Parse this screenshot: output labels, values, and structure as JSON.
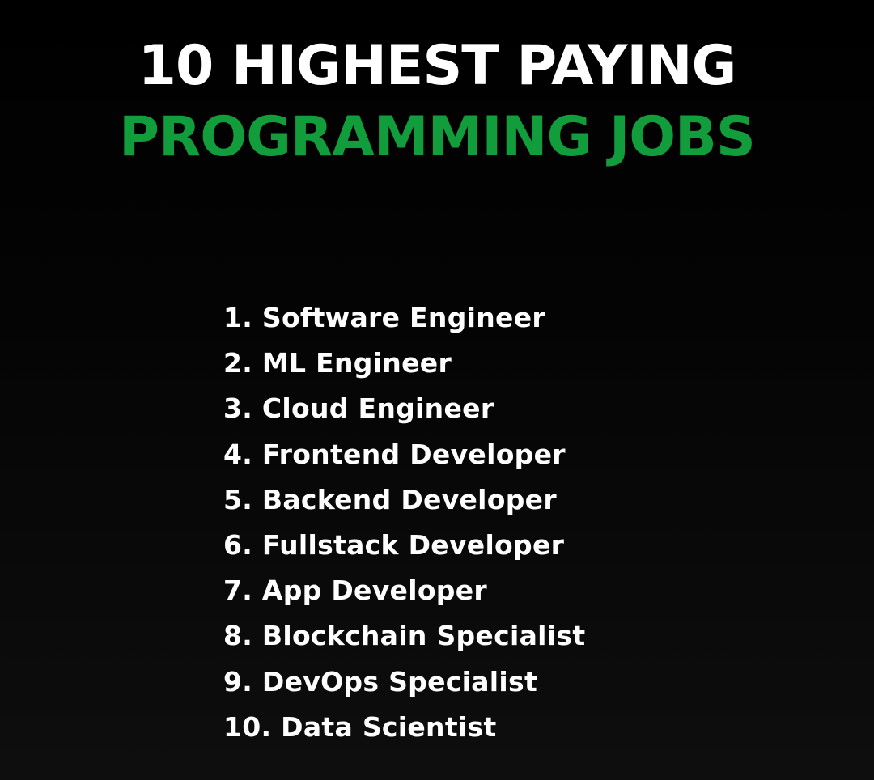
{
  "title": {
    "line1": "10 HIGHEST PAYING",
    "line2": "PROGRAMMING JOBS"
  },
  "colors": {
    "background": "#000000",
    "title_primary": "#ffffff",
    "title_accent": "#129d3c",
    "list_text": "#ffffff"
  },
  "jobs": [
    "1. Software Engineer",
    "2. ML Engineer",
    "3. Cloud Engineer",
    "4. Frontend Developer",
    "5. Backend Developer",
    "6. Fullstack Developer",
    "7. App Developer",
    "8. Blockchain Specialist",
    "9. DevOps Specialist",
    "10. Data Scientist"
  ]
}
